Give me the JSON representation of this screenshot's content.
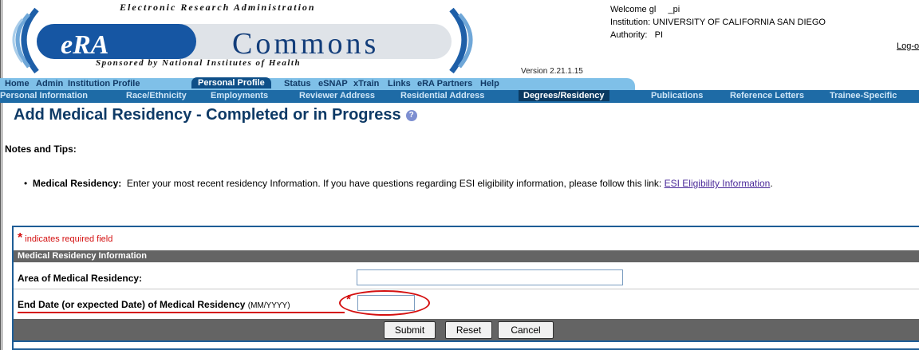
{
  "header": {
    "tagline": "Electronic Research Administration",
    "logo_era": "eRA",
    "logo_commons": "Commons",
    "sponsor": "Sponsored by National Institutes of Health",
    "version": "Version 2.21.1.15",
    "welcome": "Welcome gl     _pi",
    "institution": "Institution: UNIVERSITY OF CALIFORNIA SAN DIEGO",
    "authority": "Authority:   PI",
    "logout": "Log-out"
  },
  "nav_primary": [
    "Home",
    "Admin",
    "Institution Profile",
    "Personal Profile",
    "Status",
    "eSNAP",
    "xTrain",
    "Links",
    "eRA Partners",
    "Help"
  ],
  "nav_primary_active": "Personal Profile",
  "nav_secondary": [
    "Personal Information",
    "Race/Ethnicity",
    "Employments",
    "Reviewer Address",
    "Residential Address",
    "Degrees/Residency",
    "Publications",
    "Reference Letters",
    "Trainee-Specific"
  ],
  "nav_secondary_active": "Degrees/Residency",
  "page_title": "Add Medical Residency - Completed or in Progress",
  "notes": {
    "heading": "Notes and Tips:",
    "item_label": "Medical Residency:",
    "item_text": "Enter your most recent residency Information.  If you have questions regarding ESI eligibility information, please follow this link:",
    "link_text": "ESI Eligibility Information",
    "link_suffix": "."
  },
  "form": {
    "required_note": "indicates required field",
    "section_title": "Medical Residency Information",
    "area_label": "Area of Medical Residency:",
    "area_value": "",
    "end_date_label": "End Date (or expected Date) of Medical Residency",
    "end_date_format": "(MM/YYYY)",
    "end_date_value": "",
    "buttons": {
      "submit": "Submit",
      "reset": "Reset",
      "cancel": "Cancel"
    }
  },
  "colors": {
    "nav_light": "#7fc0e8",
    "nav_dark": "#1e6ba6",
    "title": "#0e3a66",
    "required": "#d41010",
    "section": "#646464"
  }
}
